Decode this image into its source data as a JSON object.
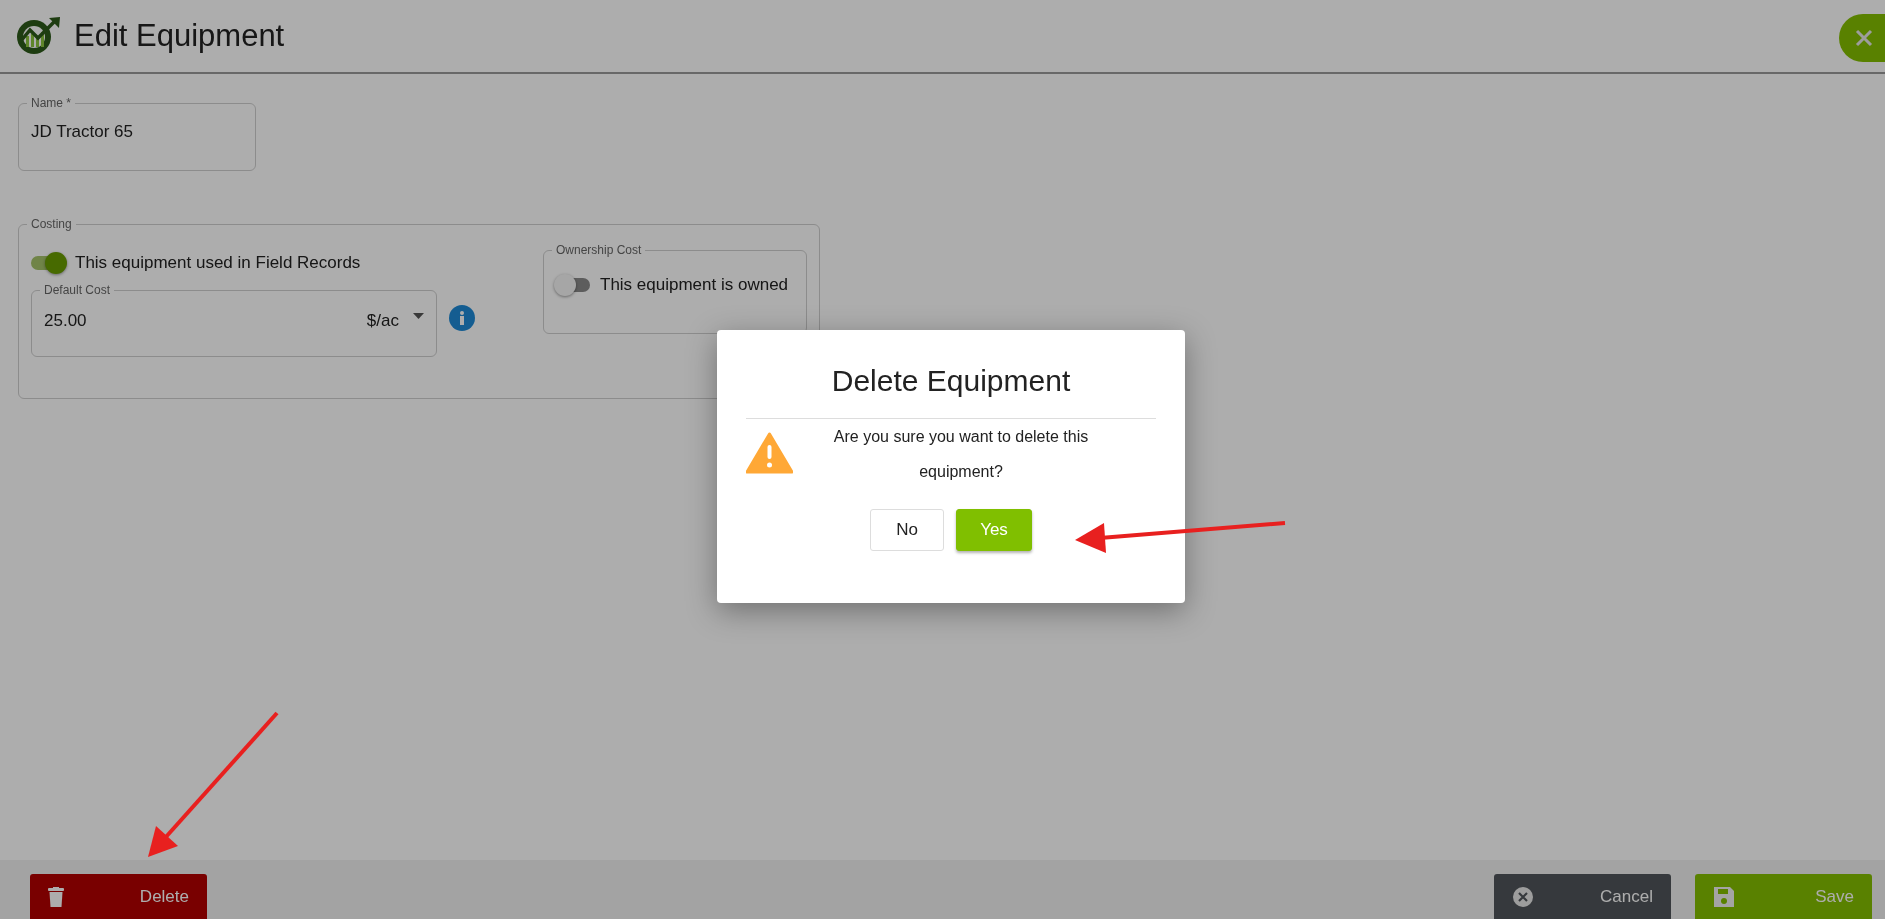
{
  "header": {
    "title": "Edit Equipment"
  },
  "name_field": {
    "label": "Name *",
    "value": "JD Tractor 65"
  },
  "costing": {
    "legend": "Costing",
    "used_toggle": {
      "label": "This equipment used in Field Records",
      "on": true
    },
    "default_cost": {
      "label": "Default Cost",
      "value": "25.00",
      "unit": "$/ac"
    },
    "ownership": {
      "legend": "Ownership Cost",
      "toggle": {
        "label": "This equipment is owned",
        "on": false
      }
    }
  },
  "dialog": {
    "title": "Delete Equipment",
    "message": "Are you sure you want to delete this equipment?",
    "buttons": [
      {
        "label": "No",
        "kind": "secondary"
      },
      {
        "label": "Yes",
        "kind": "primary"
      }
    ]
  },
  "footer": {
    "buttons": [
      {
        "label": "Delete",
        "kind": "delete"
      },
      {
        "label": "Cancel",
        "kind": "cancel"
      },
      {
        "label": "Save",
        "kind": "save"
      }
    ]
  }
}
